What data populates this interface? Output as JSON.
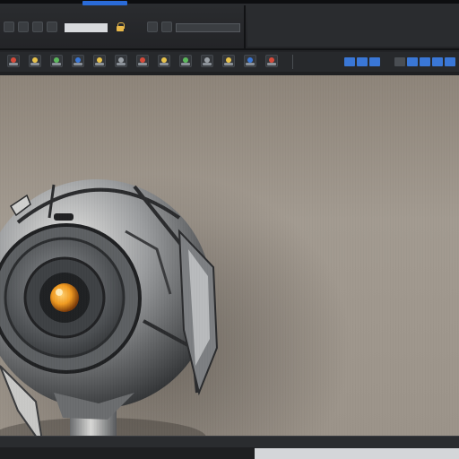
{
  "window": {
    "title_items": [
      "",
      "",
      "",
      ""
    ],
    "title_right": "",
    "field_value": ""
  },
  "toolbar": {
    "tools": [
      {
        "name": "tool-1",
        "color": "#d64a3a"
      },
      {
        "name": "tool-2",
        "color": "#e8c24a"
      },
      {
        "name": "tool-3",
        "color": "#5cb85c"
      },
      {
        "name": "tool-4",
        "color": "#3a77d6"
      },
      {
        "name": "tool-5",
        "color": "#e8c24a"
      },
      {
        "name": "tool-6",
        "color": "#9aa0a6"
      },
      {
        "name": "tool-7",
        "color": "#d64a3a"
      },
      {
        "name": "tool-8",
        "color": "#e8c24a"
      },
      {
        "name": "tool-9",
        "color": "#5cb85c"
      },
      {
        "name": "tool-10",
        "color": "#9aa0a6"
      },
      {
        "name": "tool-11",
        "color": "#e8c24a"
      },
      {
        "name": "tool-12",
        "color": "#3a77d6"
      },
      {
        "name": "tool-13",
        "color": "#d64a3a"
      }
    ]
  },
  "viewport": {
    "subject": "spherical-robot-model",
    "eye_color": "#f0a020",
    "background_color": "#9b9389"
  },
  "colors": {
    "accent": "#2a6bd8",
    "chrome": "#2b2d30"
  }
}
